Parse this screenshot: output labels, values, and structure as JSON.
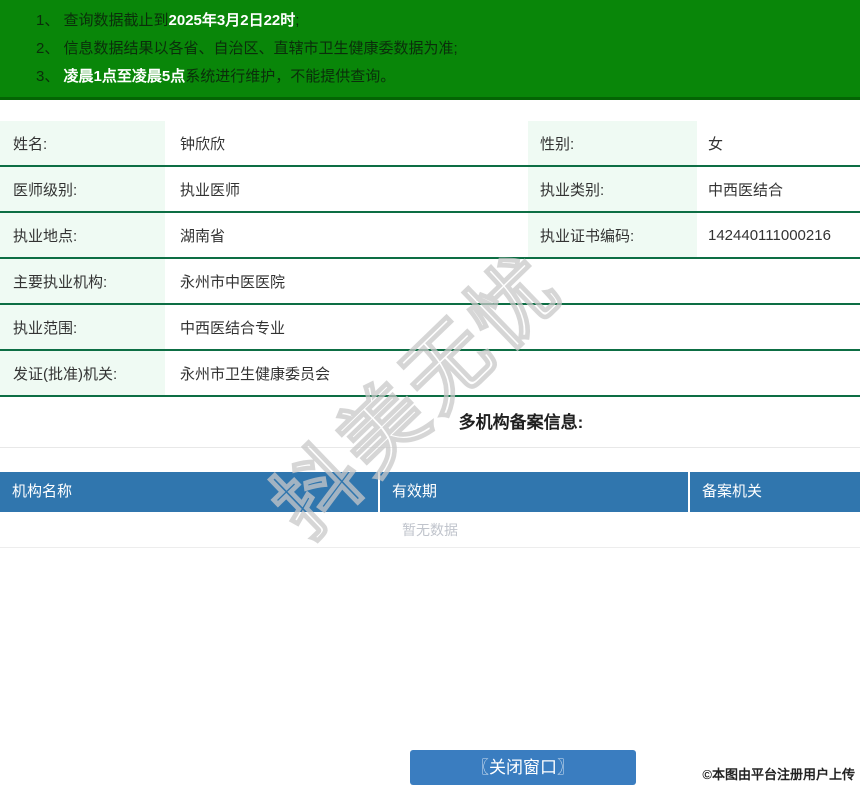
{
  "theme": {
    "banner_green": "#098609",
    "banner_border": "#046504",
    "row_border_green": "#0d6e44",
    "label_bg": "#effaf3",
    "table_header_blue": "#3076ae",
    "button_blue": "#3a7dc0",
    "empty_text_gray": "#c0c4cc"
  },
  "banner": {
    "notices": [
      {
        "prefix": "1、 查询数据截止到",
        "highlight": "2025年3月2日22时",
        "suffix": ";"
      },
      {
        "prefix": "2、 信息数据结果以各省、自治区、直辖市卫生健康委数据为准;",
        "highlight": "",
        "suffix": ""
      },
      {
        "prefix": "3、 ",
        "highlight": "凌晨1点至凌晨5点",
        "suffix": "系统进行维护，不能提供查询。"
      }
    ]
  },
  "info": {
    "fields": {
      "name": {
        "label": "姓名:",
        "value": "钟欣欣"
      },
      "gender": {
        "label": "性别:",
        "value": "女"
      },
      "doctor_level": {
        "label": "医师级别:",
        "value": "执业医师"
      },
      "practice_category": {
        "label": "执业类别:",
        "value": "中西医结合"
      },
      "practice_location": {
        "label": "执业地点:",
        "value": "湖南省"
      },
      "certificate_no": {
        "label": "执业证书编码:",
        "value": "142440111000216"
      },
      "primary_institution": {
        "label": "主要执业机构:",
        "value": "永州市中医医院"
      },
      "practice_scope": {
        "label": "执业范围:",
        "value": "中西医结合专业"
      },
      "issuing_authority": {
        "label": "发证(批准)机关:",
        "value": "永州市卫生健康委员会"
      }
    }
  },
  "records": {
    "section_title": "多机构备案信息:",
    "columns": [
      "机构名称",
      "有效期",
      "备案机关"
    ],
    "empty_text": "暂无数据"
  },
  "watermark": {
    "text": "抖美无忧"
  },
  "footer": {
    "close_button_label": "〖关闭窗口〗",
    "stamp_text": "©本图由平台注册用户上传"
  }
}
